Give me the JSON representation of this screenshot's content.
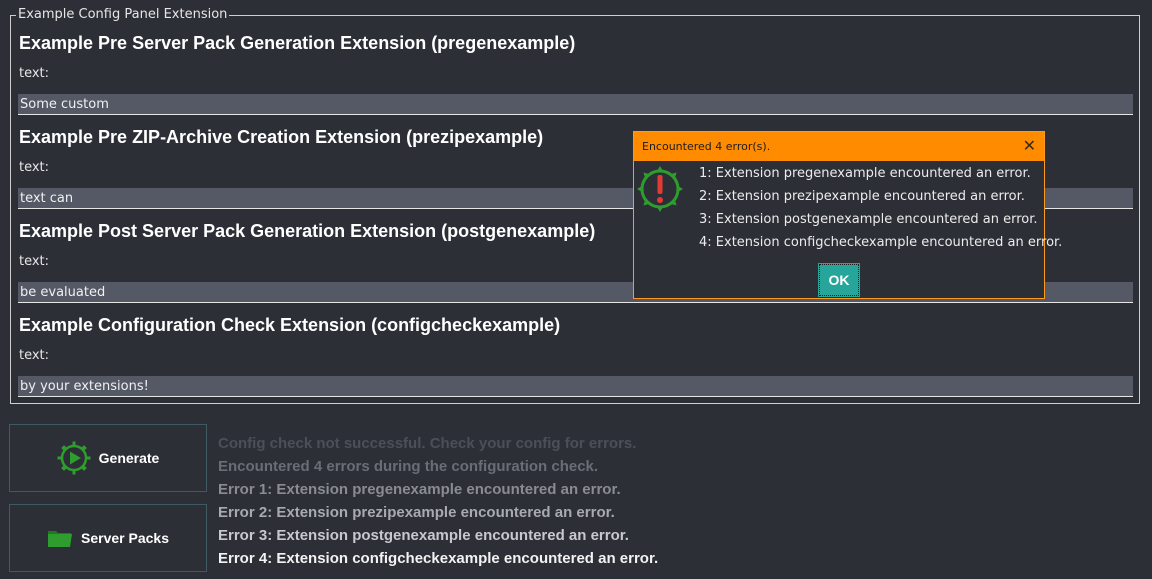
{
  "panel": {
    "title": "Example Config Panel Extension",
    "extensions": [
      {
        "heading": "Example Pre Server Pack Generation Extension (pregenexample)",
        "label": "text:",
        "value": "Some custom"
      },
      {
        "heading": "Example Pre ZIP-Archive Creation Extension (prezipexample)",
        "label": "text:",
        "value": "text can"
      },
      {
        "heading": "Example Post Server Pack Generation Extension (postgenexample)",
        "label": "text:",
        "value": "be evaluated"
      },
      {
        "heading": "Example Configuration Check Extension (configcheckexample)",
        "label": "text:",
        "value": "by your extensions!"
      }
    ]
  },
  "buttons": {
    "generate_label": "Generate",
    "server_packs_label": "Server Packs"
  },
  "log": {
    "lines": [
      "Config check not successful. Check your config for errors.",
      "Encountered 4 errors during the configuration check.",
      "Error 1: Extension pregenexample encountered an error.",
      "Error 2: Extension prezipexample encountered an error.",
      "Error 3: Extension postgenexample encountered an error.",
      "Error 4: Extension configcheckexample encountered an error."
    ],
    "colors": [
      "#4c4f58",
      "#6a6d75",
      "#8a8c92",
      "#a8aab0",
      "#c8c9cd",
      "#f2f2f2"
    ]
  },
  "dialog": {
    "title": "Encountered 4 error(s).",
    "close_icon": "close-icon",
    "messages": [
      "1: Extension pregenexample encountered an error.",
      "2: Extension prezipexample encountered an error.",
      "3: Extension postgenexample encountered an error.",
      "4: Extension configcheckexample encountered an error."
    ],
    "ok_label": "OK",
    "accent": "#ff8c00"
  },
  "icons": {
    "generate": "play-gear-icon",
    "server_packs": "folder-icon",
    "dialog": "error-gear-icon"
  }
}
